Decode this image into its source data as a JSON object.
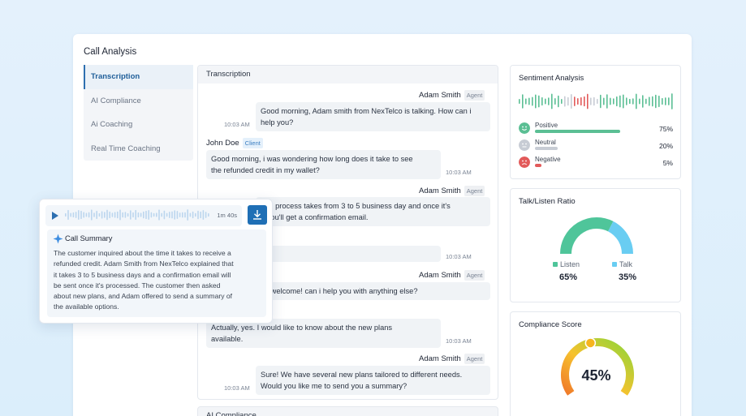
{
  "page": {
    "title": "Call Analysis"
  },
  "sidebar": {
    "items": [
      {
        "label": "Transcription",
        "active": true
      },
      {
        "label": "AI Compliance"
      },
      {
        "label": "Ai Coaching"
      },
      {
        "label": "Real Time Coaching"
      }
    ]
  },
  "transcription": {
    "title": "Transcription",
    "messages": [
      {
        "speaker": "Adam Smith",
        "role": "Agent",
        "text_lines": [
          "Good morning, Adam smith from NexTelco is talking. How can i",
          "help you?"
        ],
        "time": "10:03 AM"
      },
      {
        "speaker": "John Doe",
        "role": "Client",
        "text_lines": [
          "Good morning, i was wondering how long does it take to see",
          "the refunded credit in my wallet?"
        ],
        "time": "10:03 AM"
      },
      {
        "speaker": "Adam Smith",
        "role": "Agent",
        "text_lines": [
          "und process takes from 3 to 5 business day and once it's",
          "e you'll get a confirmation email."
        ]
      },
      {
        "time": "10:03 AM"
      },
      {
        "speaker": "Adam Smith",
        "role": "Agent",
        "text_lines": [
          "'re welcome! can i help you with anything else?"
        ]
      },
      {
        "text_lines": [
          "Actually, yes. I would like to know about the new plans",
          "available."
        ],
        "time": "10:03 AM"
      },
      {
        "speaker": "Adam Smith",
        "role": "Agent",
        "text_lines": [
          "Sure! We have several new plans tailored to different needs.",
          "Would you like me to send you a summary?"
        ],
        "time": "10:03 AM"
      }
    ]
  },
  "ai_compliance_section": {
    "title": "AI Compliance"
  },
  "sentiment": {
    "title": "Sentiment Analysis",
    "items": [
      {
        "label": "Positive",
        "value": "75%",
        "fraction": 0.75,
        "color": "#5bbf94",
        "icon": "happy-face-icon"
      },
      {
        "label": "Neutral",
        "value": "20%",
        "fraction": 0.2,
        "color": "#c7ccd4",
        "icon": "neutral-face-icon"
      },
      {
        "label": "Negative",
        "value": "5%",
        "fraction": 0.05,
        "color": "#e25a5a",
        "icon": "sad-face-icon"
      }
    ]
  },
  "talk_listen": {
    "title": "Talk/Listen Ratio",
    "listen_label": "Listen",
    "listen_value": "65%",
    "listen_fraction": 0.65,
    "listen_color": "#4fc59a",
    "talk_label": "Talk",
    "talk_value": "35%",
    "talk_fraction": 0.35,
    "talk_color": "#69cdf2"
  },
  "compliance": {
    "title": "Compliance Score",
    "value": "45%",
    "fraction": 0.45
  },
  "summary_popup": {
    "duration": "1m 40s",
    "title": "Call Summary",
    "lines": [
      "The customer inquired about the time it takes to receive a",
      "refunded credit. Adam Smith from NexTelco explained that",
      "it takes 3 to 5 business days and a confirmation email will",
      "be sent once it's processed. The customer then asked",
      "about new plans, and Adam offered to send a summary of",
      "the available options."
    ]
  }
}
